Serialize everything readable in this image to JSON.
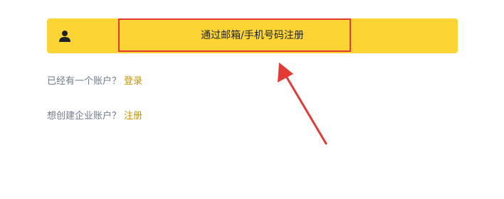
{
  "signup": {
    "button_label": "通过邮箱/手机号码注册",
    "icon": "user-icon"
  },
  "login_prompt": {
    "text": "已经有一个账户？",
    "link": "登录"
  },
  "enterprise_prompt": {
    "text": "想创建企业账户？",
    "link": "注册"
  },
  "colors": {
    "button_bg": "#fcd535",
    "link": "#c99400",
    "muted_text": "#707a8a",
    "annotation": "#e53935"
  }
}
